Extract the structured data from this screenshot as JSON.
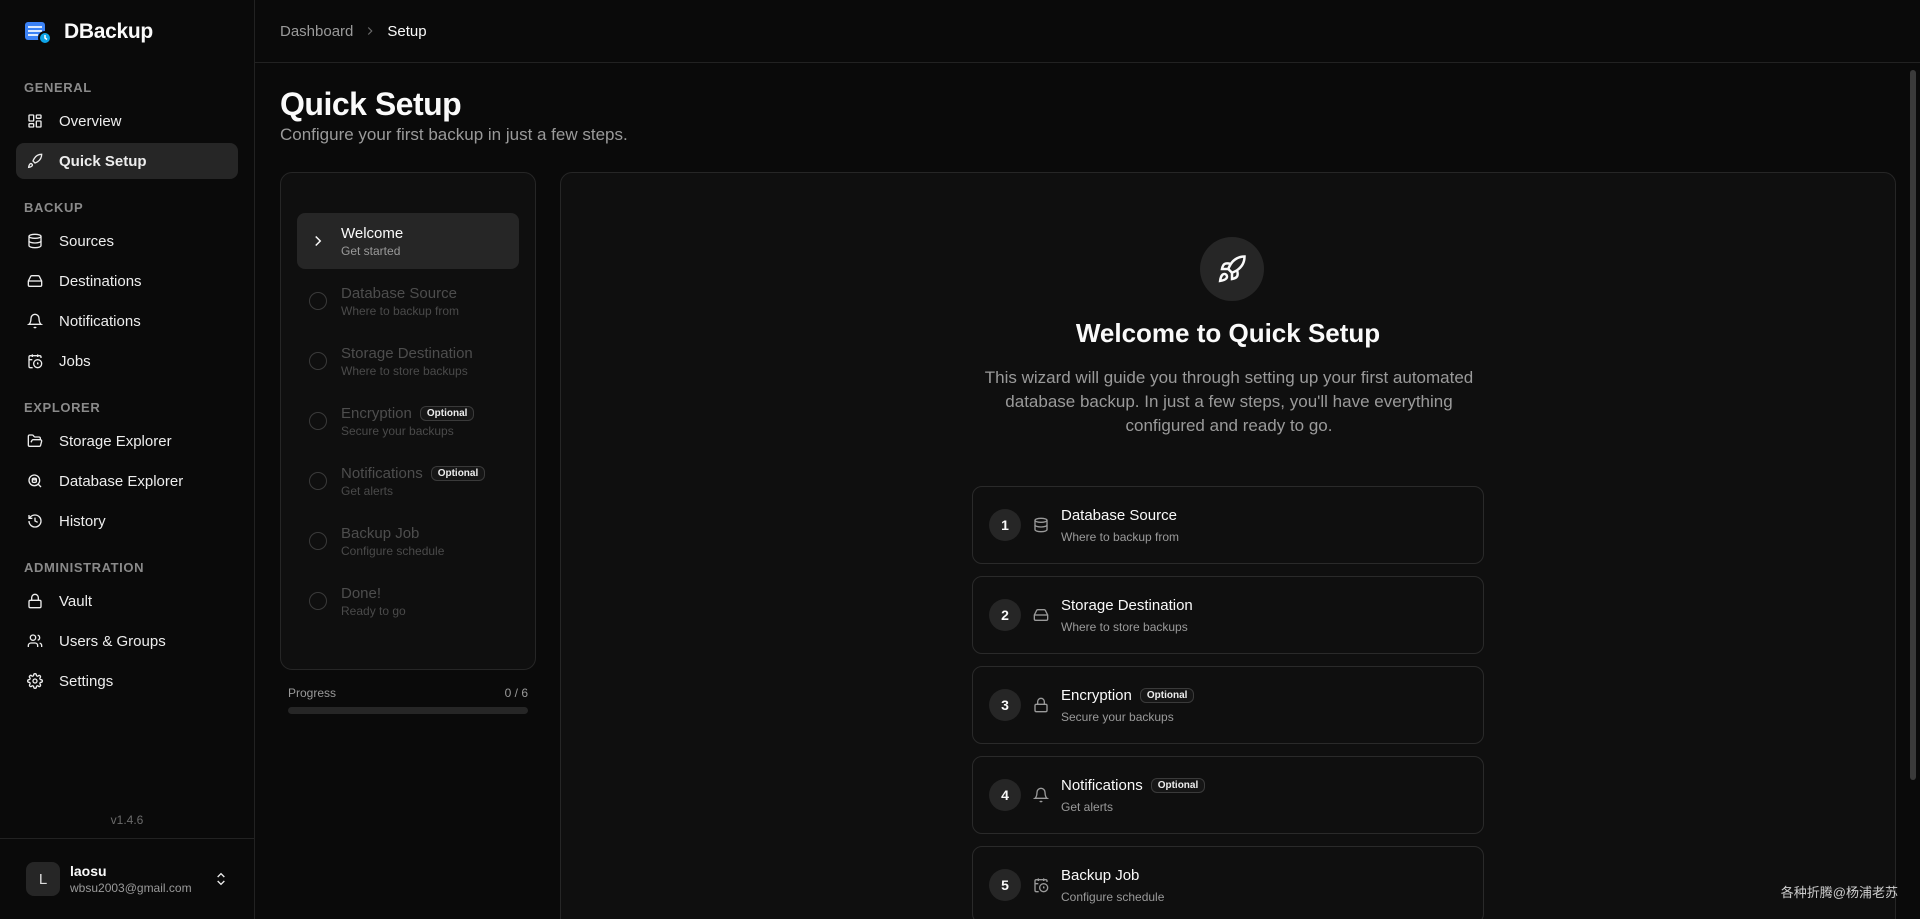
{
  "app": {
    "name": "DBackup",
    "version": "v1.4.6"
  },
  "sidebar": {
    "groups": [
      {
        "label": "GENERAL",
        "items": [
          {
            "label": "Overview",
            "icon": "grid-icon",
            "active": false
          },
          {
            "label": "Quick Setup",
            "icon": "rocket-icon",
            "active": true
          }
        ]
      },
      {
        "label": "BACKUP",
        "items": [
          {
            "label": "Sources",
            "icon": "database-icon"
          },
          {
            "label": "Destinations",
            "icon": "hard-drive-icon"
          },
          {
            "label": "Notifications",
            "icon": "bell-icon"
          },
          {
            "label": "Jobs",
            "icon": "calendar-clock-icon"
          }
        ]
      },
      {
        "label": "EXPLORER",
        "items": [
          {
            "label": "Storage Explorer",
            "icon": "folder-open-icon"
          },
          {
            "label": "Database Explorer",
            "icon": "search-database-icon"
          },
          {
            "label": "History",
            "icon": "history-icon"
          }
        ]
      },
      {
        "label": "ADMINISTRATION",
        "items": [
          {
            "label": "Vault",
            "icon": "lock-icon"
          },
          {
            "label": "Users & Groups",
            "icon": "users-icon"
          },
          {
            "label": "Settings",
            "icon": "gear-icon"
          }
        ]
      }
    ]
  },
  "user": {
    "initial": "L",
    "name": "laosu",
    "email": "wbsu2003@gmail.com"
  },
  "breadcrumb": {
    "parent": "Dashboard",
    "current": "Setup"
  },
  "page": {
    "title": "Quick Setup",
    "subtitle": "Configure your first backup in just a few steps."
  },
  "steps": [
    {
      "title": "Welcome",
      "subtitle": "Get started",
      "active": true,
      "badge": ""
    },
    {
      "title": "Database Source",
      "subtitle": "Where to backup from",
      "active": false,
      "badge": ""
    },
    {
      "title": "Storage Destination",
      "subtitle": "Where to store backups",
      "active": false,
      "badge": ""
    },
    {
      "title": "Encryption",
      "subtitle": "Secure your backups",
      "active": false,
      "badge": "Optional"
    },
    {
      "title": "Notifications",
      "subtitle": "Get alerts",
      "active": false,
      "badge": "Optional"
    },
    {
      "title": "Backup Job",
      "subtitle": "Configure schedule",
      "active": false,
      "badge": ""
    },
    {
      "title": "Done!",
      "subtitle": "Ready to go",
      "active": false,
      "badge": ""
    }
  ],
  "progress": {
    "label": "Progress",
    "value_text": "0 / 6",
    "fraction": 0
  },
  "welcome": {
    "title": "Welcome to Quick Setup",
    "description": "This wizard will guide you through setting up your first automated database backup. In just a few steps, you'll have everything configured and ready to go.",
    "items": [
      {
        "num": "1",
        "title": "Database Source",
        "subtitle": "Where to backup from",
        "icon": "database-icon",
        "badge": ""
      },
      {
        "num": "2",
        "title": "Storage Destination",
        "subtitle": "Where to store backups",
        "icon": "hard-drive-icon",
        "badge": ""
      },
      {
        "num": "3",
        "title": "Encryption",
        "subtitle": "Secure your backups",
        "icon": "lock-icon",
        "badge": "Optional"
      },
      {
        "num": "4",
        "title": "Notifications",
        "subtitle": "Get alerts",
        "icon": "bell-icon",
        "badge": "Optional"
      },
      {
        "num": "5",
        "title": "Backup Job",
        "subtitle": "Configure schedule",
        "icon": "calendar-clock-icon",
        "badge": ""
      }
    ]
  },
  "watermark": "各种折腾@杨浦老苏"
}
